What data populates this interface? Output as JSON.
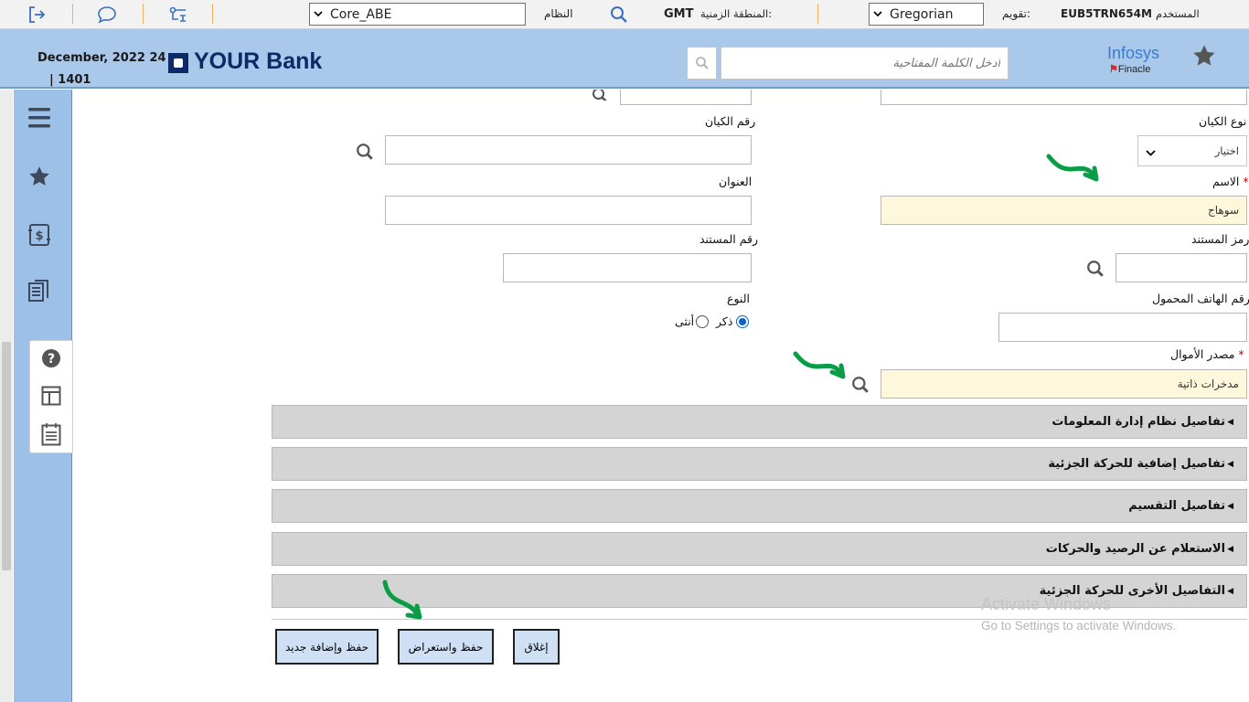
{
  "topbar": {
    "user_label": "المستخدم",
    "user_id": "EUB5TRN654M",
    "calendar_label": "تقويم:",
    "calendar_value": "Gregorian",
    "timezone_label": "المنطقة الزمنية:",
    "timezone_value": "GMT",
    "system_label": "النظام",
    "system_value": "Core_ABE"
  },
  "header": {
    "date": "December, 2022 24",
    "sub_date": "| 1401",
    "bank_name": "YOUR Bank",
    "search_placeholder": "أدخل الكلمة المفتاحية",
    "infosys": "Infosys",
    "finacle": "Finacle"
  },
  "form": {
    "entity_type_label": "نوع الكيان",
    "entity_type_value": "اختيار",
    "entity_number_label": "رقم الكيان",
    "name_label": "الاسم",
    "name_value": "سوهاج",
    "address_label": "العنوان",
    "doc_code_label": "رمز المستند",
    "doc_number_label": "رقم المستند",
    "mobile_label": "رقم الهاتف المحمول",
    "gender_label": "النوع",
    "gender_male": "ذكر",
    "gender_female": "أنثى",
    "funds_source_label": "مصدر الأموال",
    "funds_source_value": "مدخرات ذاتية",
    "required_mark": "*"
  },
  "sections": [
    {
      "label": "تفاصيل نظام إدارة المعلومات"
    },
    {
      "label": "تفاصيل إضافية للحركة الجزئية"
    },
    {
      "label": "تفاصيل التقسيم"
    },
    {
      "label": "الاستعلام عن الرصيد والحركات"
    },
    {
      "label": "التفاصيل الأخرى للحركة الجزئية"
    }
  ],
  "buttons": {
    "save_add_new": "حفظ وإضافة جديد",
    "save_review": "حفظ واستعراض",
    "close": "إغلاق"
  },
  "watermark": {
    "line1": "Activate Windows",
    "line2": "Go to Settings to activate Windows."
  },
  "colors": {
    "header_bg": "#a9c8ea",
    "sidebar_bg": "#9dc0e8",
    "mandatory_bg": "#fdf8dc",
    "arrow_green": "#0b9c47",
    "button_bg": "#cfe0f5"
  }
}
